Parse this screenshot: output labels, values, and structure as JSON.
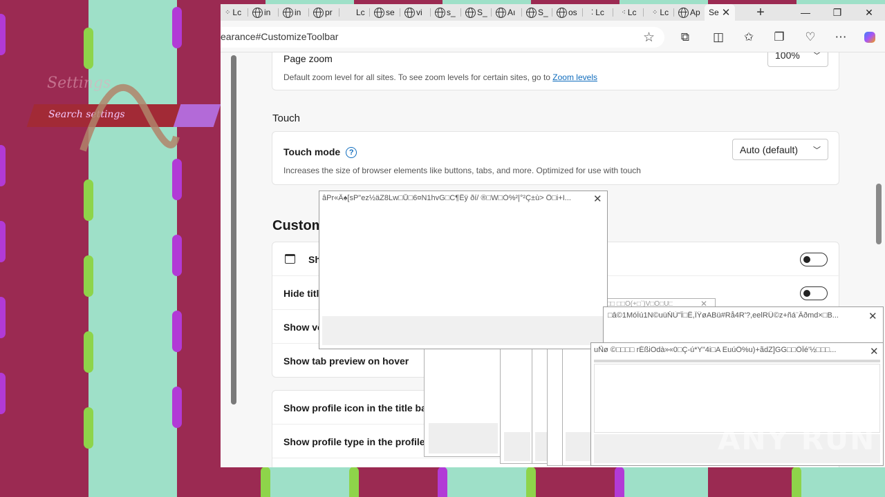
{
  "tabs": [
    {
      "label": "Lc",
      "icon": "loading-icon"
    },
    {
      "label": "in",
      "icon": "globe-icon"
    },
    {
      "label": "in",
      "icon": "globe-icon"
    },
    {
      "label": "pr",
      "icon": "globe-icon"
    },
    {
      "label": "Lc",
      "icon": "blank"
    },
    {
      "label": "se",
      "icon": "globe-icon"
    },
    {
      "label": "vi",
      "icon": "globe-icon"
    },
    {
      "label": "s_",
      "icon": "globe-icon"
    },
    {
      "label": "S_",
      "icon": "globe-icon"
    },
    {
      "label": "Aı",
      "icon": "globe-icon"
    },
    {
      "label": "S_",
      "icon": "globe-icon"
    },
    {
      "label": "os",
      "icon": "globe-icon"
    },
    {
      "label": "Lc",
      "icon": "loading-icon"
    },
    {
      "label": "Lc",
      "icon": "loading-icon"
    },
    {
      "label": "Lc",
      "icon": "loading-icon"
    },
    {
      "label": "Ap",
      "icon": "globe-icon"
    }
  ],
  "active_tab": {
    "label": "Se"
  },
  "window": {
    "new_tab": "+",
    "minimize": "—",
    "restore": "❐",
    "close": "✕"
  },
  "address": {
    "url": "earance#CustomizeToolbar"
  },
  "settings": {
    "page_zoom": {
      "label": "Page zoom",
      "desc": "Default zoom level for all sites. To see zoom levels for certain sites, go to",
      "link": "Zoom levels",
      "value": "100%"
    },
    "touch_section": "Touch",
    "touch_mode": {
      "label": "Touch mode",
      "desc": "Increases the size of browser elements like buttons, tabs, and more. Optimized for use with touch",
      "value": "Auto (default)"
    },
    "customize_title": "Custom",
    "rows": [
      {
        "label": "Sh",
        "toggle": "off"
      },
      {
        "label": "Hide titl",
        "toggle": "off"
      },
      {
        "label": "Show ve"
      },
      {
        "label": "Show tab preview on hover"
      }
    ],
    "rows2": [
      {
        "label": "Show profile icon in the title bar"
      },
      {
        "label": "Show profile type in the profile l"
      }
    ]
  },
  "background": {
    "settings_text": "Settings",
    "search_text": "Search settings"
  },
  "dialogs": {
    "d1_title": "âPr«Â♠[sP\"ez½äZ8Lw□Ů□6¤N1hvG□C¶Êÿ ðí/ ®□W□Ò%²|°²Ç±ù> Ô□i+I...",
    "d2_title": "□â©1MóÏú1N©uüŇÙ\"Î□Ê,ÏŸøAΒü#Rå4R'?,eelRÜ©z+ñá¨Âðmd×□B...",
    "d3_title": "uÑø ©□□□□ rÉßiOdà»«0□Ç-ú*Y\"4i□A EuúÔ%u)+ãdZ]GG□□ÔÎé'½□□□...",
    "d4_title": "□□ □□Ô(+□`)V□Ô□U□",
    "close": "✕"
  },
  "watermark": "ANY RUN",
  "colors": {
    "accent": "#0f6cbd",
    "bg_magenta": "#9b2a52",
    "bg_mint": "#9ee0c8"
  }
}
